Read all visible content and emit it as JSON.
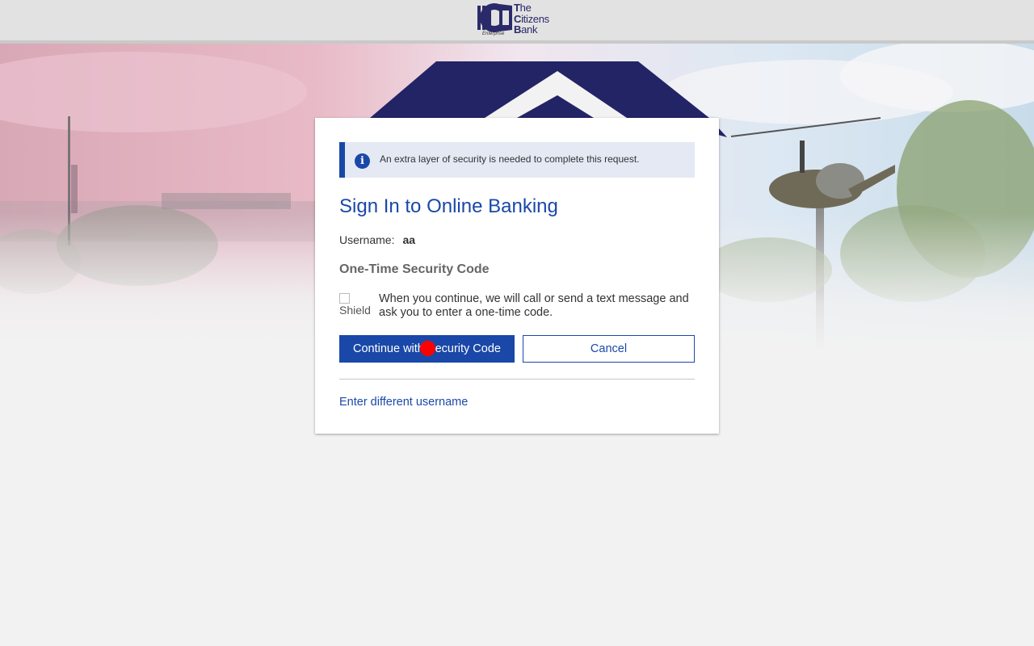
{
  "header": {
    "logo_line1": "The",
    "logo_line2": "Citizens",
    "logo_line3": "Bank",
    "logo_sub": "Enterprise",
    "logo_alt": "The Citizens Bank"
  },
  "alert": {
    "icon": "info-icon",
    "text": "An extra layer of security is needed to complete this request."
  },
  "form": {
    "title": "Sign In to Online Banking",
    "username_label": "Username:",
    "username_value": "aa",
    "otp_title": "One-Time Security Code",
    "shield_alt": "Shield",
    "description": "When you continue, we will call or send a text message and ask you to enter a one-time code.",
    "continue_label": "Continue with Security Code",
    "cancel_label": "Cancel",
    "different_username_label": "Enter different username"
  },
  "colors": {
    "accent": "#1a48a8",
    "logo": "#2a2a6a",
    "alert_bg": "#e4e9f4",
    "page_bg": "#f2f2f2"
  }
}
